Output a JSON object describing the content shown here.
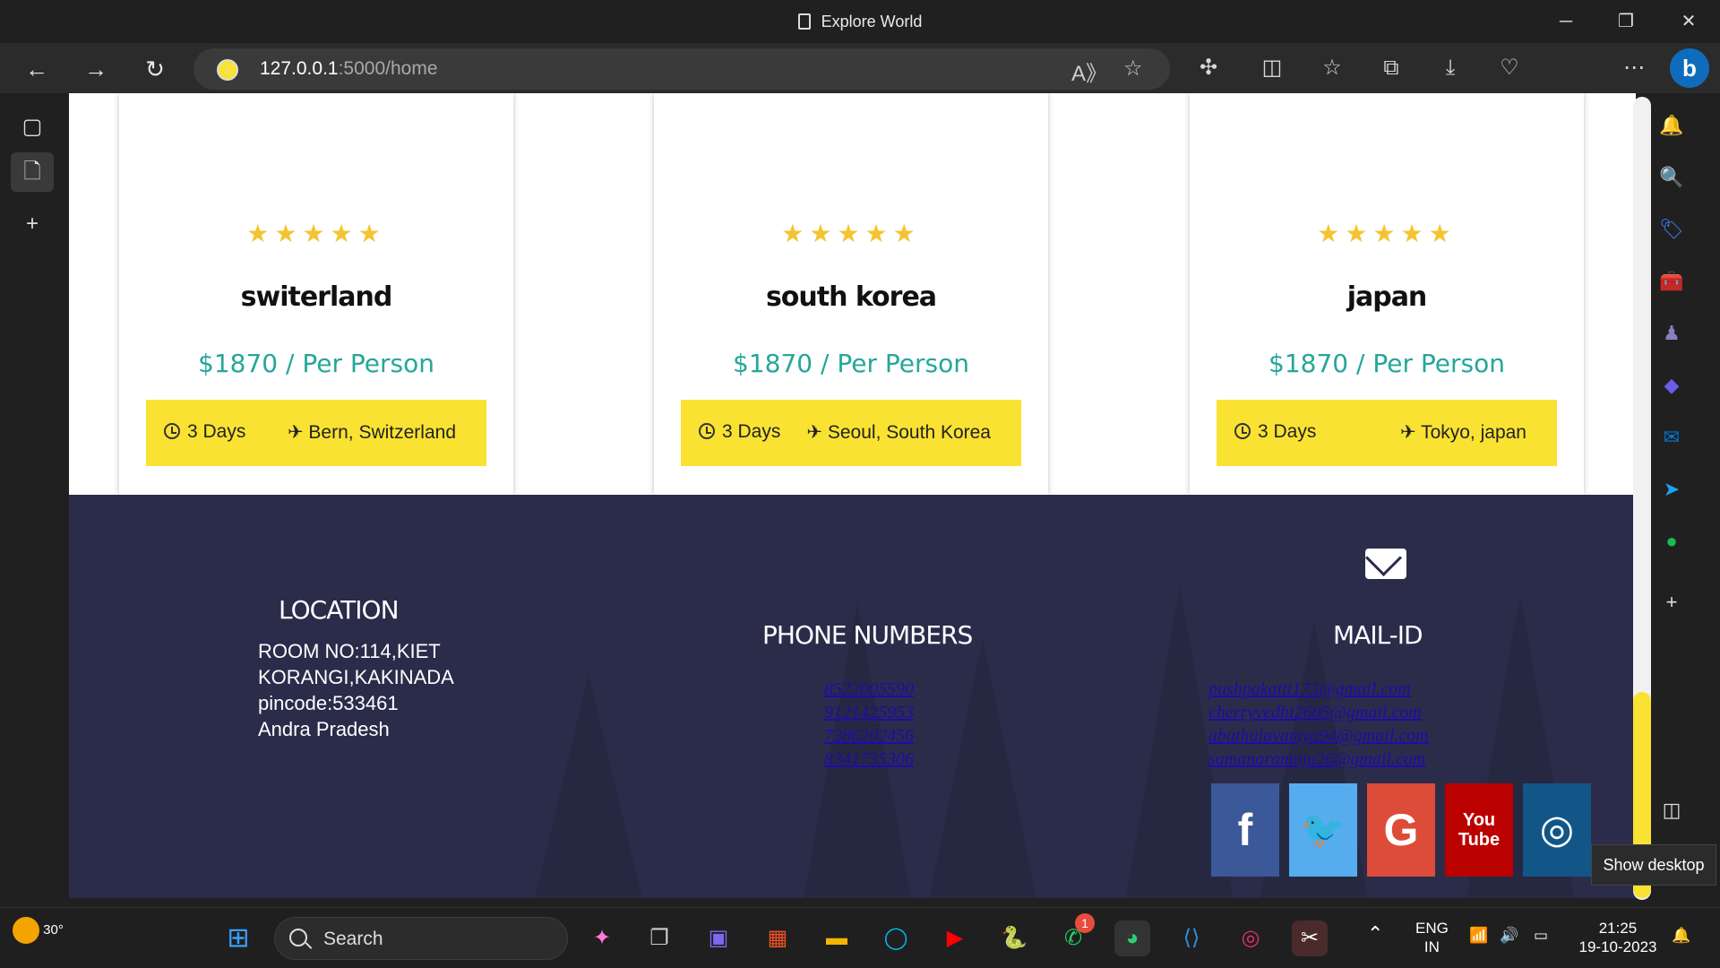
{
  "window": {
    "title": "Explore World"
  },
  "address_bar": {
    "host": "127.0.0.1",
    "path": ":5000/home"
  },
  "cards": [
    {
      "name": "switerland",
      "price": "$1870 / Per Person",
      "days": "3 Days",
      "location": "Bern, Switzerland",
      "rating": 5
    },
    {
      "name": "south korea",
      "price": "$1870 / Per Person",
      "days": "3 Days",
      "location": "Seoul, South Korea",
      "rating": 5
    },
    {
      "name": "japan",
      "price": "$1870 / Per Person",
      "days": "3 Days",
      "location": "Tokyo, japan",
      "rating": 5
    }
  ],
  "footer": {
    "location": {
      "heading": "LOCATION",
      "lines": [
        "ROOM NO:114,KIET",
        "KORANGI,KAKINADA",
        "pincode:533461",
        "Andra Pradesh"
      ]
    },
    "phones": {
      "heading": "PHONE NUMBERS",
      "numbers": [
        "8522005590",
        "9121425953",
        "7386202456",
        "8341735306"
      ]
    },
    "mail": {
      "heading": "MAIL-ID",
      "emails": [
        "pushpakatti173@gmail.com",
        "cherryvedhi2605@gmail.com",
        "abathulavamya94@gmail.com",
        "samanaramoju26@gmail.com"
      ]
    },
    "social": [
      {
        "name": "facebook",
        "glyph": "f",
        "color": "#3b5998"
      },
      {
        "name": "twitter",
        "glyph": "🐦",
        "color": "#55acee"
      },
      {
        "name": "google",
        "glyph": "G",
        "color": "#dd4b39"
      },
      {
        "name": "youtube",
        "glyph": "You Tube",
        "color": "#bb0000"
      },
      {
        "name": "instagram",
        "glyph": "◎",
        "color": "#125688"
      }
    ]
  },
  "tooltip": {
    "show_desktop": "Show desktop"
  },
  "taskbar": {
    "weather_temp": "30°",
    "search_label": "Search",
    "whatsapp_badge": "1",
    "lang_top": "ENG",
    "lang_bottom": "IN",
    "time": "21:25",
    "date": "19-10-2023"
  }
}
